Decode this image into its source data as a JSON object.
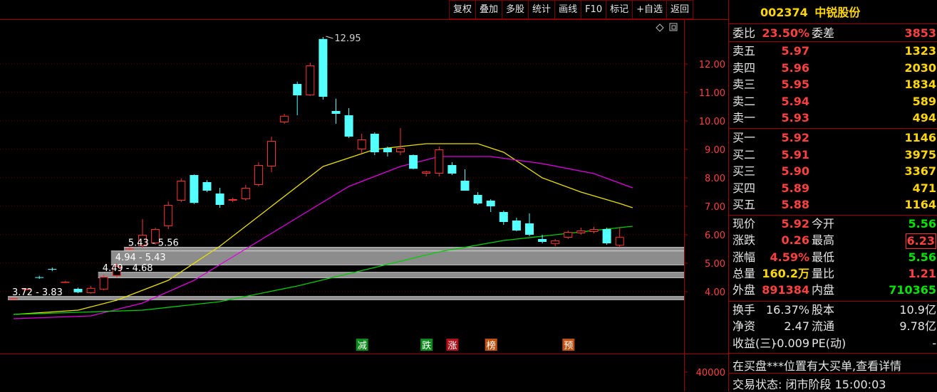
{
  "toolbar": {
    "buttons": [
      "复权",
      "叠加",
      "多股",
      "统计",
      "画线",
      "F10",
      "标记",
      "+自选",
      "返回"
    ]
  },
  "chart_data": {
    "type": "candlestick",
    "price_axis": {
      "ticks": [
        12.0,
        11.0,
        10.0,
        9.0,
        8.0,
        7.0,
        6.0,
        5.0,
        4.0
      ],
      "ylim": [
        3.2,
        13.5
      ]
    },
    "volume_axis": {
      "ticks": [
        40000
      ]
    },
    "candles": [
      {
        "o": 3.76,
        "h": 3.78,
        "l": 3.74,
        "c": 3.77
      },
      {
        "o": 4.1,
        "h": 4.12,
        "l": 4.08,
        "c": 4.1
      },
      {
        "o": 4.51,
        "h": 4.56,
        "l": 4.45,
        "c": 4.5
      },
      {
        "o": 4.8,
        "h": 4.85,
        "l": 4.72,
        "c": 4.78
      },
      {
        "o": 4.35,
        "h": 4.38,
        "l": 4.32,
        "c": 4.35
      },
      {
        "o": 4.1,
        "h": 4.14,
        "l": 3.95,
        "c": 3.98
      },
      {
        "o": 3.95,
        "h": 4.2,
        "l": 3.93,
        "c": 4.13
      },
      {
        "o": 4.08,
        "h": 4.6,
        "l": 4.05,
        "c": 4.52
      },
      {
        "o": 4.55,
        "h": 5.0,
        "l": 4.5,
        "c": 4.9
      },
      {
        "o": 5.5,
        "h": 5.56,
        "l": 5.46,
        "c": 5.52
      },
      {
        "o": 5.6,
        "h": 6.55,
        "l": 5.55,
        "c": 6.0
      },
      {
        "o": 5.7,
        "h": 6.25,
        "l": 5.65,
        "c": 6.2
      },
      {
        "o": 6.3,
        "h": 7.17,
        "l": 6.2,
        "c": 7.05
      },
      {
        "o": 7.2,
        "h": 7.98,
        "l": 7.15,
        "c": 7.9
      },
      {
        "o": 8.1,
        "h": 8.12,
        "l": 7.08,
        "c": 7.12
      },
      {
        "o": 7.85,
        "h": 7.92,
        "l": 7.5,
        "c": 7.55
      },
      {
        "o": 7.45,
        "h": 7.65,
        "l": 6.95,
        "c": 7.05
      },
      {
        "o": 7.2,
        "h": 7.3,
        "l": 7.15,
        "c": 7.25
      },
      {
        "o": 7.25,
        "h": 7.75,
        "l": 7.2,
        "c": 7.65
      },
      {
        "o": 7.75,
        "h": 8.55,
        "l": 7.7,
        "c": 8.45
      },
      {
        "o": 8.4,
        "h": 9.45,
        "l": 8.2,
        "c": 9.3
      },
      {
        "o": 9.95,
        "h": 10.25,
        "l": 9.9,
        "c": 10.18
      },
      {
        "o": 11.3,
        "h": 11.38,
        "l": 10.2,
        "c": 10.9
      },
      {
        "o": 10.9,
        "h": 12.05,
        "l": 10.88,
        "c": 11.95
      },
      {
        "o": 12.88,
        "h": 12.95,
        "l": 10.75,
        "c": 10.85
      },
      {
        "o": 10.35,
        "h": 10.78,
        "l": 9.9,
        "c": 10.25
      },
      {
        "o": 10.2,
        "h": 10.45,
        "l": 9.4,
        "c": 9.45
      },
      {
        "o": 9.0,
        "h": 9.55,
        "l": 8.85,
        "c": 9.35
      },
      {
        "o": 9.55,
        "h": 9.6,
        "l": 8.8,
        "c": 8.9
      },
      {
        "o": 9.05,
        "h": 9.1,
        "l": 8.75,
        "c": 8.9
      },
      {
        "o": 8.9,
        "h": 9.75,
        "l": 8.8,
        "c": 9.05
      },
      {
        "o": 8.8,
        "h": 8.82,
        "l": 8.3,
        "c": 8.32
      },
      {
        "o": 8.15,
        "h": 8.25,
        "l": 8.05,
        "c": 8.22
      },
      {
        "o": 8.15,
        "h": 9.1,
        "l": 8.05,
        "c": 9.0
      },
      {
        "o": 8.45,
        "h": 8.55,
        "l": 8.1,
        "c": 8.15
      },
      {
        "o": 7.9,
        "h": 8.3,
        "l": 7.55,
        "c": 7.55
      },
      {
        "o": 7.4,
        "h": 7.5,
        "l": 7.05,
        "c": 7.1
      },
      {
        "o": 7.2,
        "h": 7.25,
        "l": 6.8,
        "c": 7.0
      },
      {
        "o": 6.8,
        "h": 6.85,
        "l": 6.35,
        "c": 6.45
      },
      {
        "o": 6.5,
        "h": 6.6,
        "l": 6.12,
        "c": 6.15
      },
      {
        "o": 6.4,
        "h": 6.75,
        "l": 5.95,
        "c": 6.0
      },
      {
        "o": 5.85,
        "h": 6.0,
        "l": 5.7,
        "c": 5.75
      },
      {
        "o": 5.68,
        "h": 5.85,
        "l": 5.6,
        "c": 5.8
      },
      {
        "o": 5.9,
        "h": 6.15,
        "l": 5.85,
        "c": 6.1
      },
      {
        "o": 6.05,
        "h": 6.25,
        "l": 6.0,
        "c": 6.15
      },
      {
        "o": 6.1,
        "h": 6.28,
        "l": 6.05,
        "c": 6.2
      },
      {
        "o": 6.2,
        "h": 6.25,
        "l": 5.65,
        "c": 5.7
      },
      {
        "o": 5.62,
        "h": 6.25,
        "l": 5.56,
        "c": 5.92
      }
    ],
    "ma_lines": [
      {
        "color": "#e8e000",
        "points": [
          [
            0,
            3.2
          ],
          [
            5,
            3.35
          ],
          [
            8,
            3.7
          ],
          [
            12,
            4.4
          ],
          [
            16,
            5.6
          ],
          [
            20,
            7.0
          ],
          [
            24,
            8.4
          ],
          [
            28,
            9.0
          ],
          [
            32,
            9.2
          ],
          [
            36,
            9.2
          ],
          [
            38,
            8.9
          ],
          [
            41,
            8.0
          ],
          [
            44,
            7.5
          ],
          [
            47,
            7.1
          ],
          [
            48,
            6.95
          ]
        ]
      },
      {
        "color": "#e000e0",
        "points": [
          [
            0,
            3.05
          ],
          [
            6,
            3.15
          ],
          [
            10,
            3.6
          ],
          [
            14,
            4.4
          ],
          [
            18,
            5.5
          ],
          [
            22,
            6.6
          ],
          [
            26,
            7.7
          ],
          [
            30,
            8.4
          ],
          [
            33,
            8.75
          ],
          [
            37,
            8.75
          ],
          [
            41,
            8.5
          ],
          [
            45,
            8.15
          ],
          [
            48,
            7.65
          ]
        ]
      },
      {
        "color": "#00d000",
        "points": [
          [
            0,
            3.2
          ],
          [
            10,
            3.35
          ],
          [
            16,
            3.65
          ],
          [
            22,
            4.2
          ],
          [
            28,
            4.85
          ],
          [
            33,
            5.4
          ],
          [
            38,
            5.8
          ],
          [
            43,
            6.05
          ],
          [
            48,
            6.3
          ]
        ]
      }
    ],
    "annotations": [
      {
        "text": "12.95",
        "candle": 24,
        "price": 12.95
      },
      {
        "text": "5.43 - 5.56",
        "y0": 5.43,
        "y1": 5.56,
        "x_start_candle": 9
      },
      {
        "text": "4.94 - 5.43",
        "y0": 4.94,
        "y1": 5.43,
        "x_start_candle": 8
      },
      {
        "text": "4.49 - 4.68",
        "y0": 4.49,
        "y1": 4.68,
        "x_start_candle": 7
      },
      {
        "text": "3.72 - 3.83",
        "y0": 3.72,
        "y1": 3.83,
        "x_start_candle": 0
      }
    ],
    "event_tags": [
      {
        "text": "减",
        "candle": 27,
        "color": "#0c8a1c"
      },
      {
        "text": "跌",
        "candle": 32,
        "color": "#0c8a1c"
      },
      {
        "text": "涨",
        "candle": 34,
        "color": "#b0101a"
      },
      {
        "text": "榜",
        "candle": 37,
        "color": "#c05010"
      },
      {
        "text": "预",
        "candle": 43,
        "color": "#c05010"
      }
    ]
  },
  "quote": {
    "code": "002374",
    "name": "中锐股份",
    "weibi": {
      "label": "委比",
      "value": "23.50%",
      "label2": "委差",
      "value2": "3853"
    },
    "sell": [
      {
        "label": "卖五",
        "price": "5.97",
        "vol": "1323"
      },
      {
        "label": "卖四",
        "price": "5.96",
        "vol": "2030"
      },
      {
        "label": "卖三",
        "price": "5.95",
        "vol": "1834"
      },
      {
        "label": "卖二",
        "price": "5.94",
        "vol": "589"
      },
      {
        "label": "卖一",
        "price": "5.93",
        "vol": "494"
      }
    ],
    "buy": [
      {
        "label": "买一",
        "price": "5.92",
        "vol": "1146"
      },
      {
        "label": "买二",
        "price": "5.91",
        "vol": "3975"
      },
      {
        "label": "买三",
        "price": "5.90",
        "vol": "3367"
      },
      {
        "label": "买四",
        "price": "5.89",
        "vol": "471"
      },
      {
        "label": "买五",
        "price": "5.88",
        "vol": "1164"
      }
    ],
    "stats": [
      {
        "l1": "现价",
        "v1": "5.92",
        "c1": "red",
        "l2": "今开",
        "v2": "5.56",
        "c2": "green",
        "box": false
      },
      {
        "l1": "涨跌",
        "v1": "0.26",
        "c1": "red",
        "l2": "最高",
        "v2": "6.23",
        "c2": "red",
        "box": true
      },
      {
        "l1": "涨幅",
        "v1": "4.59%",
        "c1": "red",
        "l2": "最低",
        "v2": "5.56",
        "c2": "green",
        "box": false
      },
      {
        "l1": "总量",
        "v1": "160.2万",
        "c1": "yellow",
        "l2": "量比",
        "v2": "1.21",
        "c2": "red",
        "box": false
      },
      {
        "l1": "外盘",
        "v1": "891384",
        "c1": "red",
        "l2": "内盘",
        "v2": "710365",
        "c2": "green",
        "box": false
      }
    ],
    "fundamentals": [
      {
        "l1": "换手",
        "v1": "16.37%",
        "l2": "股本",
        "v2": "10.9亿"
      },
      {
        "l1": "净资",
        "v1": "2.47",
        "l2": "流通",
        "v2": "9.78亿"
      },
      {
        "l1": "收益(三)",
        "v1": "-0.009",
        "l2": "PE(动)",
        "v2": "-"
      }
    ],
    "message": "在买盘***位置有大买单,查看详情",
    "trade_status": "交易状态: 闭市阶段 15:00:03"
  }
}
